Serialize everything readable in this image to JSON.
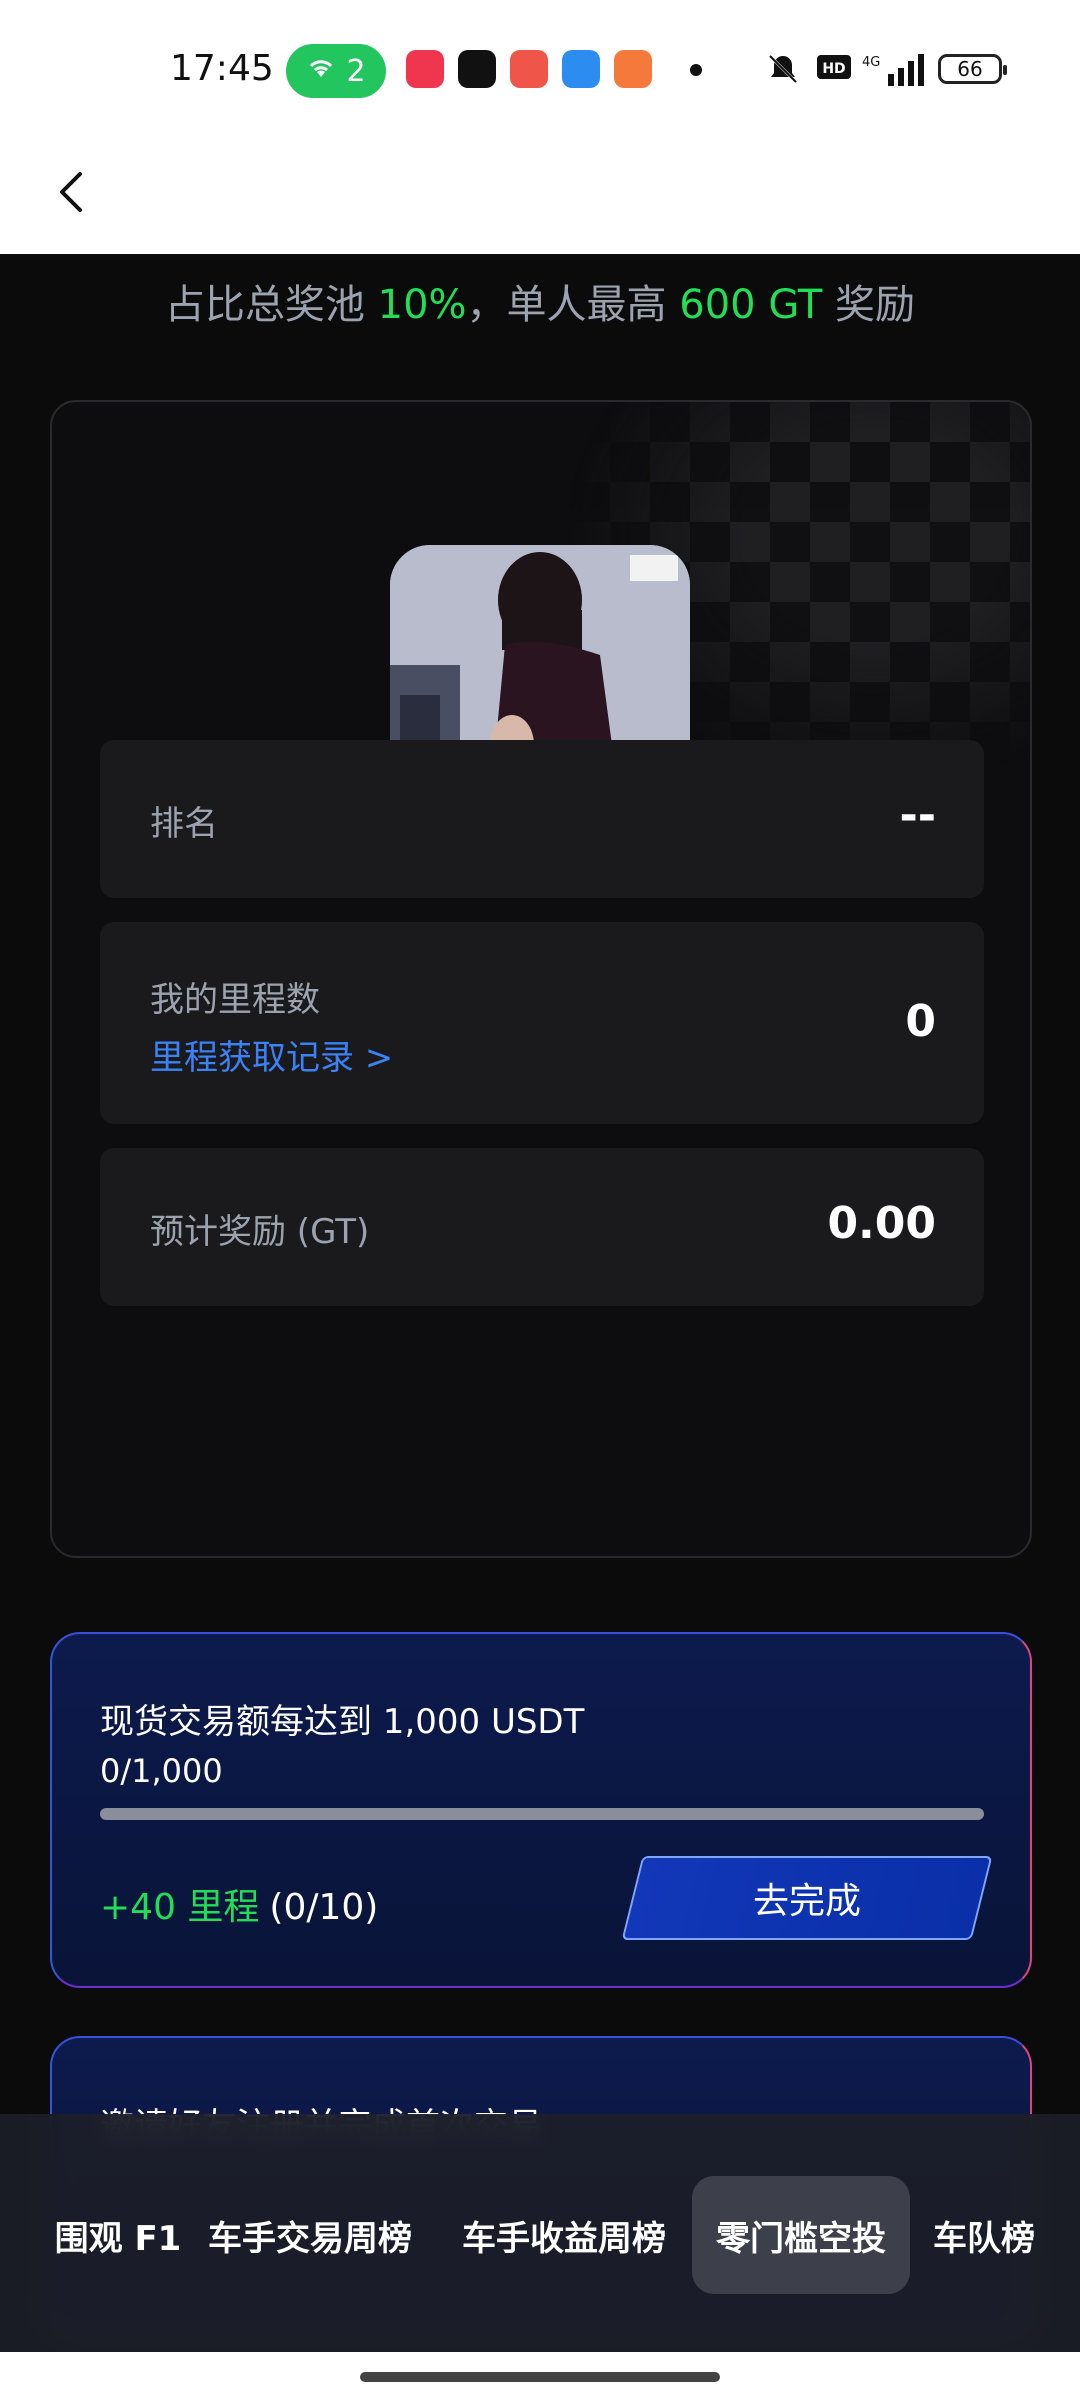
{
  "status_bar": {
    "time": "17:45",
    "wifi_count": "2",
    "network": "4G",
    "battery": "66"
  },
  "colors": {
    "accent_green": "#22dd55",
    "link_blue": "#3b82f6",
    "card_bg": "#1a1a1d"
  },
  "header": {
    "subtitle_prefix": "占比总奖池 ",
    "subtitle_pct": "10%",
    "subtitle_mid": "，单人最高 ",
    "subtitle_amount": "600 GT",
    "subtitle_suffix": " 奖励"
  },
  "stats": {
    "rank_label": "排名",
    "rank_value": "--",
    "mileage_label": "我的里程数",
    "mileage_link": "里程获取记录 >",
    "mileage_value": "0",
    "reward_label": "预计奖励 (GT)",
    "reward_value": "0.00"
  },
  "task1": {
    "title": "现货交易额每达到 1,000 USDT",
    "progress_text": "0/1,000",
    "progress_fraction": 0,
    "reward_points": "+40 里程",
    "reward_count": "(0/10)",
    "button_label": "去完成"
  },
  "task2": {
    "title": "邀请好友注册并完成首次交易"
  },
  "tabs": [
    {
      "label": "围观 F1"
    },
    {
      "label": "车手交易周榜"
    },
    {
      "label": "车手收益周榜"
    },
    {
      "label": "零门槛空投"
    },
    {
      "label": "车队榜"
    }
  ]
}
